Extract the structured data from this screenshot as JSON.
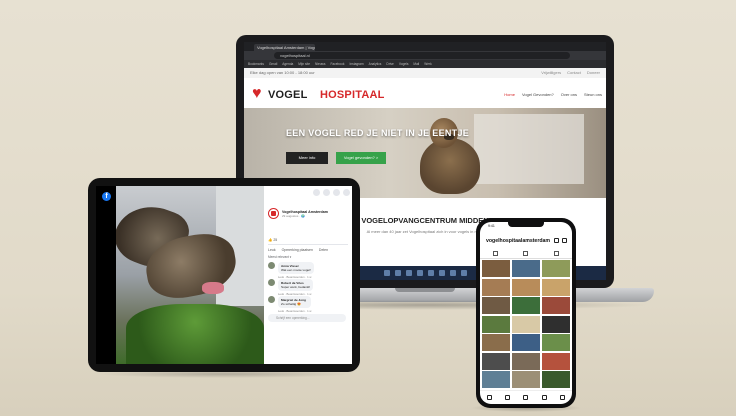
{
  "laptop": {
    "browser": {
      "tab_title": "Vogelhospitaal Amsterdam | Vogel...",
      "url": "vogelhospitaal.nl",
      "bookmarks": [
        "Bookmarks",
        "Gmail",
        "Agenda",
        "Mijn site",
        "Nieuws",
        "Facebook",
        "Instagram",
        "Analytics",
        "Drive",
        "Vogels",
        "Mail",
        "Werk"
      ]
    },
    "site": {
      "hours_text": "Elke dag open van 10:00 - 18:00 uur",
      "topbar_links": [
        "Vrijwilligers",
        "Contact",
        "Doneer"
      ],
      "logo_part1": "VOGEL",
      "logo_part2": "HOSPITAAL",
      "nav": [
        "Home",
        "Vogel Gevonden?",
        "Over ons",
        "Steun ons"
      ],
      "hero_title": "EEN VOGEL RED JE NIET IN JE EENTJE",
      "hero_btn_primary": "Meer info",
      "hero_btn_secondary": "Vogel gevonden? >",
      "section_title": "VOGELOPVANGCENTRUM MIDDEN",
      "section_sub": "Al meer dan 40 jaar zet Vogelhospitaal zich in voor vogels in nood"
    }
  },
  "tablet": {
    "fb_logo": "f",
    "page_name": "Vogelhospitaal Amsterdam",
    "post_date": "29 augustus · 🌍",
    "reactions": "👍 25",
    "actions": [
      "Leuk",
      "Opmerking plaatsen",
      "Delen"
    ],
    "comment_sort": "Meest relevant ▾",
    "comments": [
      {
        "name": "Anna Visser",
        "text": "Wat een mooie vogel!",
        "meta": "Leuk · Beantwoorden · 1 w"
      },
      {
        "name": "Robert de Vries",
        "text": "Super werk, bedankt!",
        "meta": "Leuk · Beantwoorden · 1 w"
      },
      {
        "name": "Margriet de Jong",
        "text": "Zo schattig 😍",
        "meta": "Leuk · Beantwoorden · 1 w"
      }
    ],
    "write_placeholder": "Schrijf een opmerking..."
  },
  "phone": {
    "time": "9:41",
    "handle": "vogelhospitaalamsterdam",
    "grid_colors": [
      "#7b5d3f",
      "#4a6b8a",
      "#8e9b5a",
      "#a57c54",
      "#b88c5a",
      "#c9a36a",
      "#6f5a44",
      "#3c6e3a",
      "#9b4a3a",
      "#5b7a3e",
      "#d8c9a6",
      "#2f2f2f",
      "#8a6d4b",
      "#3d5f86",
      "#6b8f4a",
      "#4d4d4d",
      "#7a6a58",
      "#b5523d",
      "#5f7f95",
      "#9c8f76",
      "#3a5a2c"
    ]
  },
  "colors": {
    "brand_red": "#d6282a",
    "cta_green": "#36a24a",
    "facebook_blue": "#1877f2"
  }
}
